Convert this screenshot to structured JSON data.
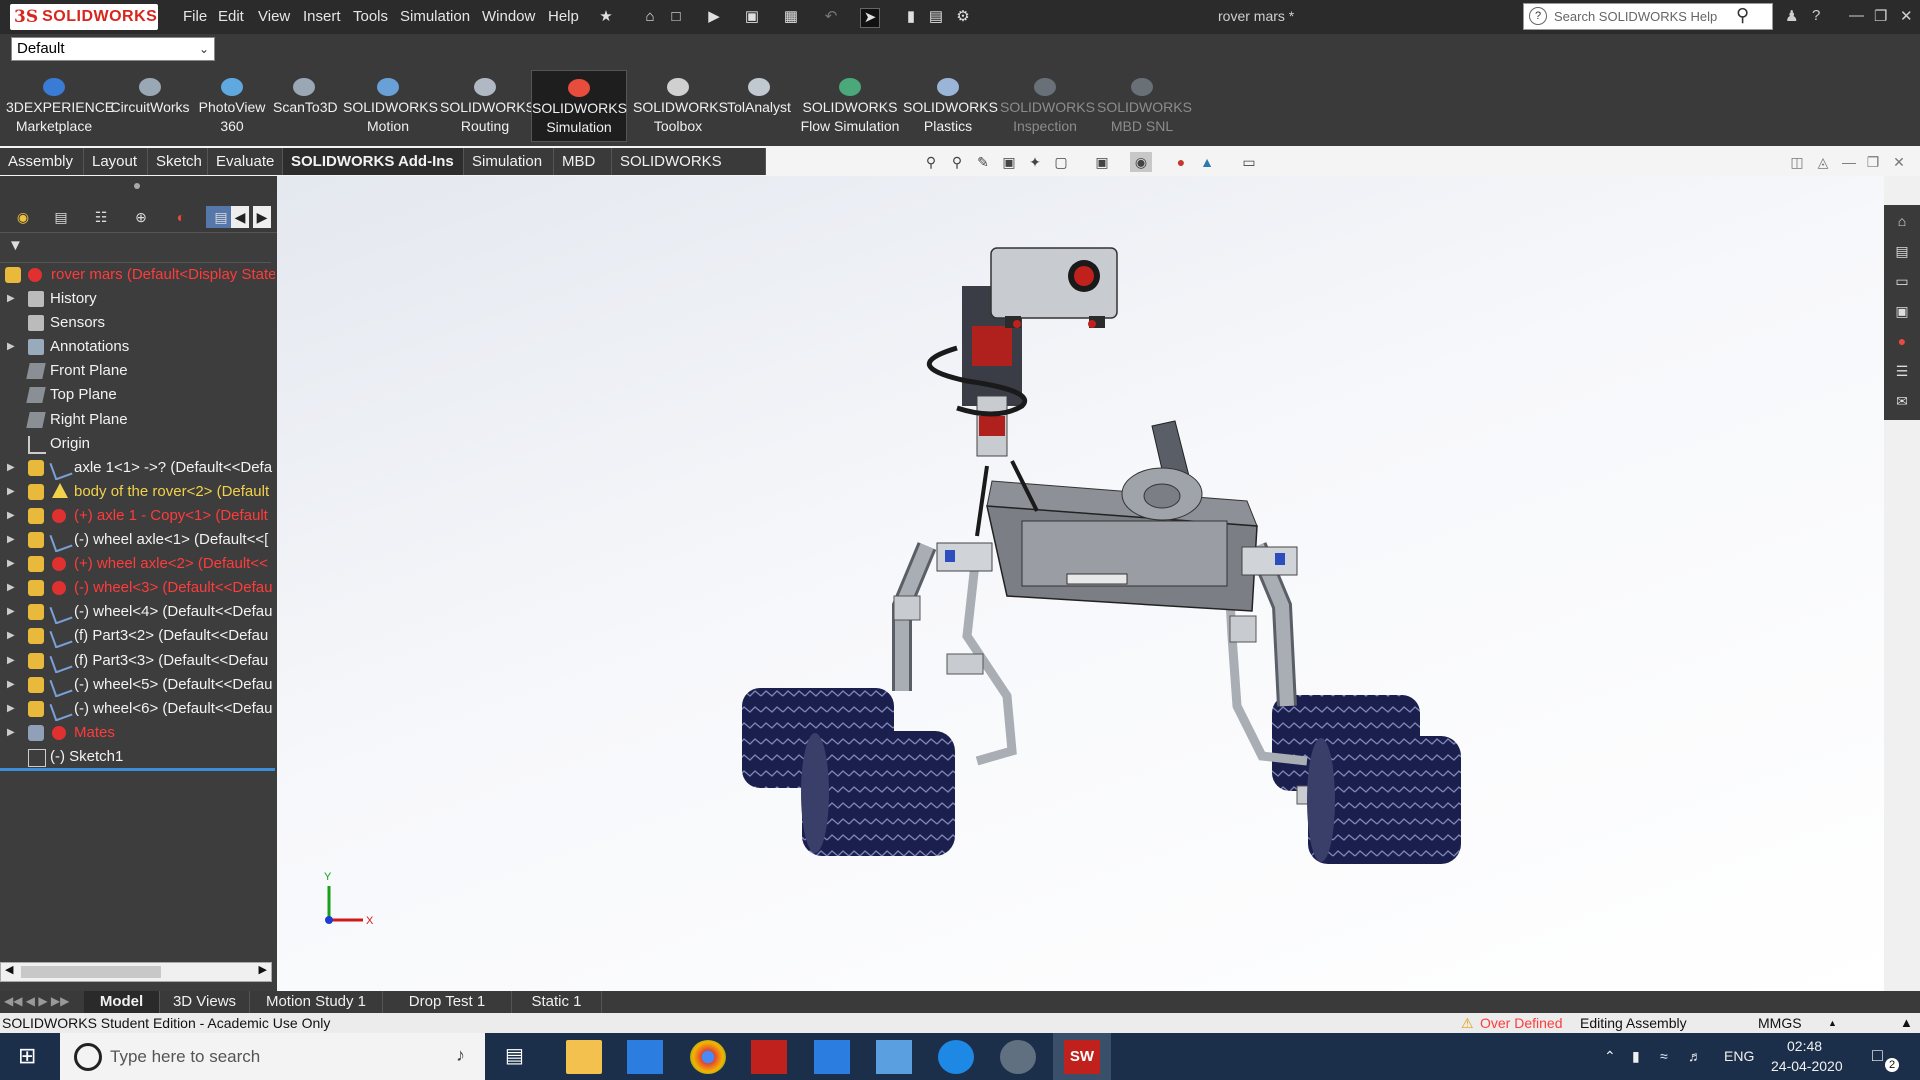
{
  "app": {
    "name": "SOLIDWORKS",
    "logo_mark": "3S",
    "document_title": "rover mars *"
  },
  "menu": [
    "File",
    "Edit",
    "View",
    "Insert",
    "Tools",
    "Simulation",
    "Window",
    "Help"
  ],
  "help_search": {
    "placeholder": "Search SOLIDWORKS Help"
  },
  "configuration": {
    "selected": "Default"
  },
  "ribbon": [
    {
      "line1": "3DEXPERIENCE",
      "line2": "Marketplace",
      "icon": "3dexperience-icon",
      "state": "normal"
    },
    {
      "line1": "CircuitWorks",
      "line2": "",
      "icon": "circuitworks-icon",
      "state": "normal"
    },
    {
      "line1": "PhotoView",
      "line2": "360",
      "icon": "photoview-icon",
      "state": "normal"
    },
    {
      "line1": "ScanTo3D",
      "line2": "",
      "icon": "scanto3d-icon",
      "state": "normal"
    },
    {
      "line1": "SOLIDWORKS",
      "line2": "Motion",
      "icon": "motion-icon",
      "state": "normal"
    },
    {
      "line1": "SOLIDWORKS",
      "line2": "Routing",
      "icon": "routing-icon",
      "state": "normal"
    },
    {
      "line1": "SOLIDWORKS",
      "line2": "Simulation",
      "icon": "simulation-icon",
      "state": "active"
    },
    {
      "line1": "SOLIDWORKS",
      "line2": "Toolbox",
      "icon": "toolbox-icon",
      "state": "normal"
    },
    {
      "line1": "TolAnalyst",
      "line2": "",
      "icon": "tolanalyst-icon",
      "state": "normal"
    },
    {
      "line1": "SOLIDWORKS",
      "line2": "Flow Simulation",
      "icon": "flow-simulation-icon",
      "state": "normal"
    },
    {
      "line1": "SOLIDWORKS",
      "line2": "Plastics",
      "icon": "plastics-icon",
      "state": "normal"
    },
    {
      "line1": "SOLIDWORKS",
      "line2": "Inspection",
      "icon": "inspection-icon",
      "state": "dim"
    },
    {
      "line1": "SOLIDWORKS",
      "line2": "MBD SNL",
      "icon": "mbd-snl-icon",
      "state": "dim"
    }
  ],
  "tabs": [
    {
      "label": "Assembly",
      "active": false
    },
    {
      "label": "Layout",
      "active": false
    },
    {
      "label": "Sketch",
      "active": false
    },
    {
      "label": "Evaluate",
      "active": false
    },
    {
      "label": "SOLIDWORKS Add-Ins",
      "active": true
    },
    {
      "label": "Simulation",
      "active": false
    },
    {
      "label": "MBD",
      "active": false
    },
    {
      "label": "SOLIDWORKS CAM",
      "active": false
    }
  ],
  "tree": {
    "root": "rover mars  (Default<Display State",
    "items": [
      {
        "label": "History",
        "expandable": true,
        "color": "normal",
        "icon": "history-icon"
      },
      {
        "label": "Sensors",
        "expandable": false,
        "color": "normal",
        "icon": "sensors-icon"
      },
      {
        "label": "Annotations",
        "expandable": true,
        "color": "normal",
        "icon": "annotations-icon"
      },
      {
        "label": "Front Plane",
        "expandable": false,
        "color": "normal",
        "icon": "plane-icon"
      },
      {
        "label": "Top Plane",
        "expandable": false,
        "color": "normal",
        "icon": "plane-icon"
      },
      {
        "label": "Right Plane",
        "expandable": false,
        "color": "normal",
        "icon": "plane-icon"
      },
      {
        "label": "Origin",
        "expandable": false,
        "color": "normal",
        "icon": "origin-icon"
      },
      {
        "label": "axle 1<1> ->? (Default<<Defa",
        "expandable": true,
        "color": "normal",
        "icon": "part-icon"
      },
      {
        "label": "body of the rover<2> (Default",
        "expandable": true,
        "color": "yellow",
        "icon": "warning-part-icon"
      },
      {
        "label": "(+) axle 1 - Copy<1> (Default",
        "expandable": true,
        "color": "red",
        "icon": "error-part-icon"
      },
      {
        "label": "(-) wheel axle<1> (Default<<[",
        "expandable": true,
        "color": "normal",
        "icon": "part-icon"
      },
      {
        "label": "(+) wheel axle<2> (Default<<",
        "expandable": true,
        "color": "red",
        "icon": "error-part-icon"
      },
      {
        "label": "(-) wheel<3> (Default<<Defau",
        "expandable": true,
        "color": "red",
        "icon": "error-part-icon"
      },
      {
        "label": "(-) wheel<4> (Default<<Defau",
        "expandable": true,
        "color": "normal",
        "icon": "part-icon"
      },
      {
        "label": "(f) Part3<2> (Default<<Defau",
        "expandable": true,
        "color": "normal",
        "icon": "part-icon"
      },
      {
        "label": "(f) Part3<3> (Default<<Defau",
        "expandable": true,
        "color": "normal",
        "icon": "part-icon"
      },
      {
        "label": "(-) wheel<5> (Default<<Defau",
        "expandable": true,
        "color": "normal",
        "icon": "part-icon"
      },
      {
        "label": "(-) wheel<6> (Default<<Defau",
        "expandable": true,
        "color": "normal",
        "icon": "part-icon"
      },
      {
        "label": "Mates",
        "expandable": true,
        "color": "red",
        "icon": "mates-icon"
      },
      {
        "label": "(-) Sketch1",
        "expandable": false,
        "color": "normal",
        "icon": "sketch-icon"
      }
    ]
  },
  "triad": {
    "x": "X",
    "y": "Y"
  },
  "bottom_tabs": [
    {
      "label": "Model",
      "active": true
    },
    {
      "label": "3D Views",
      "active": false
    },
    {
      "label": "Motion Study 1",
      "active": false
    },
    {
      "label": "Drop Test 1",
      "active": false
    },
    {
      "label": "Static 1",
      "active": false
    }
  ],
  "status": {
    "left": "SOLIDWORKS Student Edition - Academic Use Only",
    "warning": "Over Defined",
    "mode": "Editing Assembly",
    "units": "MMGS"
  },
  "taskbar": {
    "search_placeholder": "Type here to search",
    "lang": "ENG",
    "time": "02:48",
    "date": "24-04-2020",
    "notifications": "2",
    "sw_badge": "SW"
  },
  "colors": {
    "accent": "#d7261e",
    "error": "#ff3b3b",
    "warning": "#f2d14b",
    "wheel": "#1a1f4d"
  }
}
